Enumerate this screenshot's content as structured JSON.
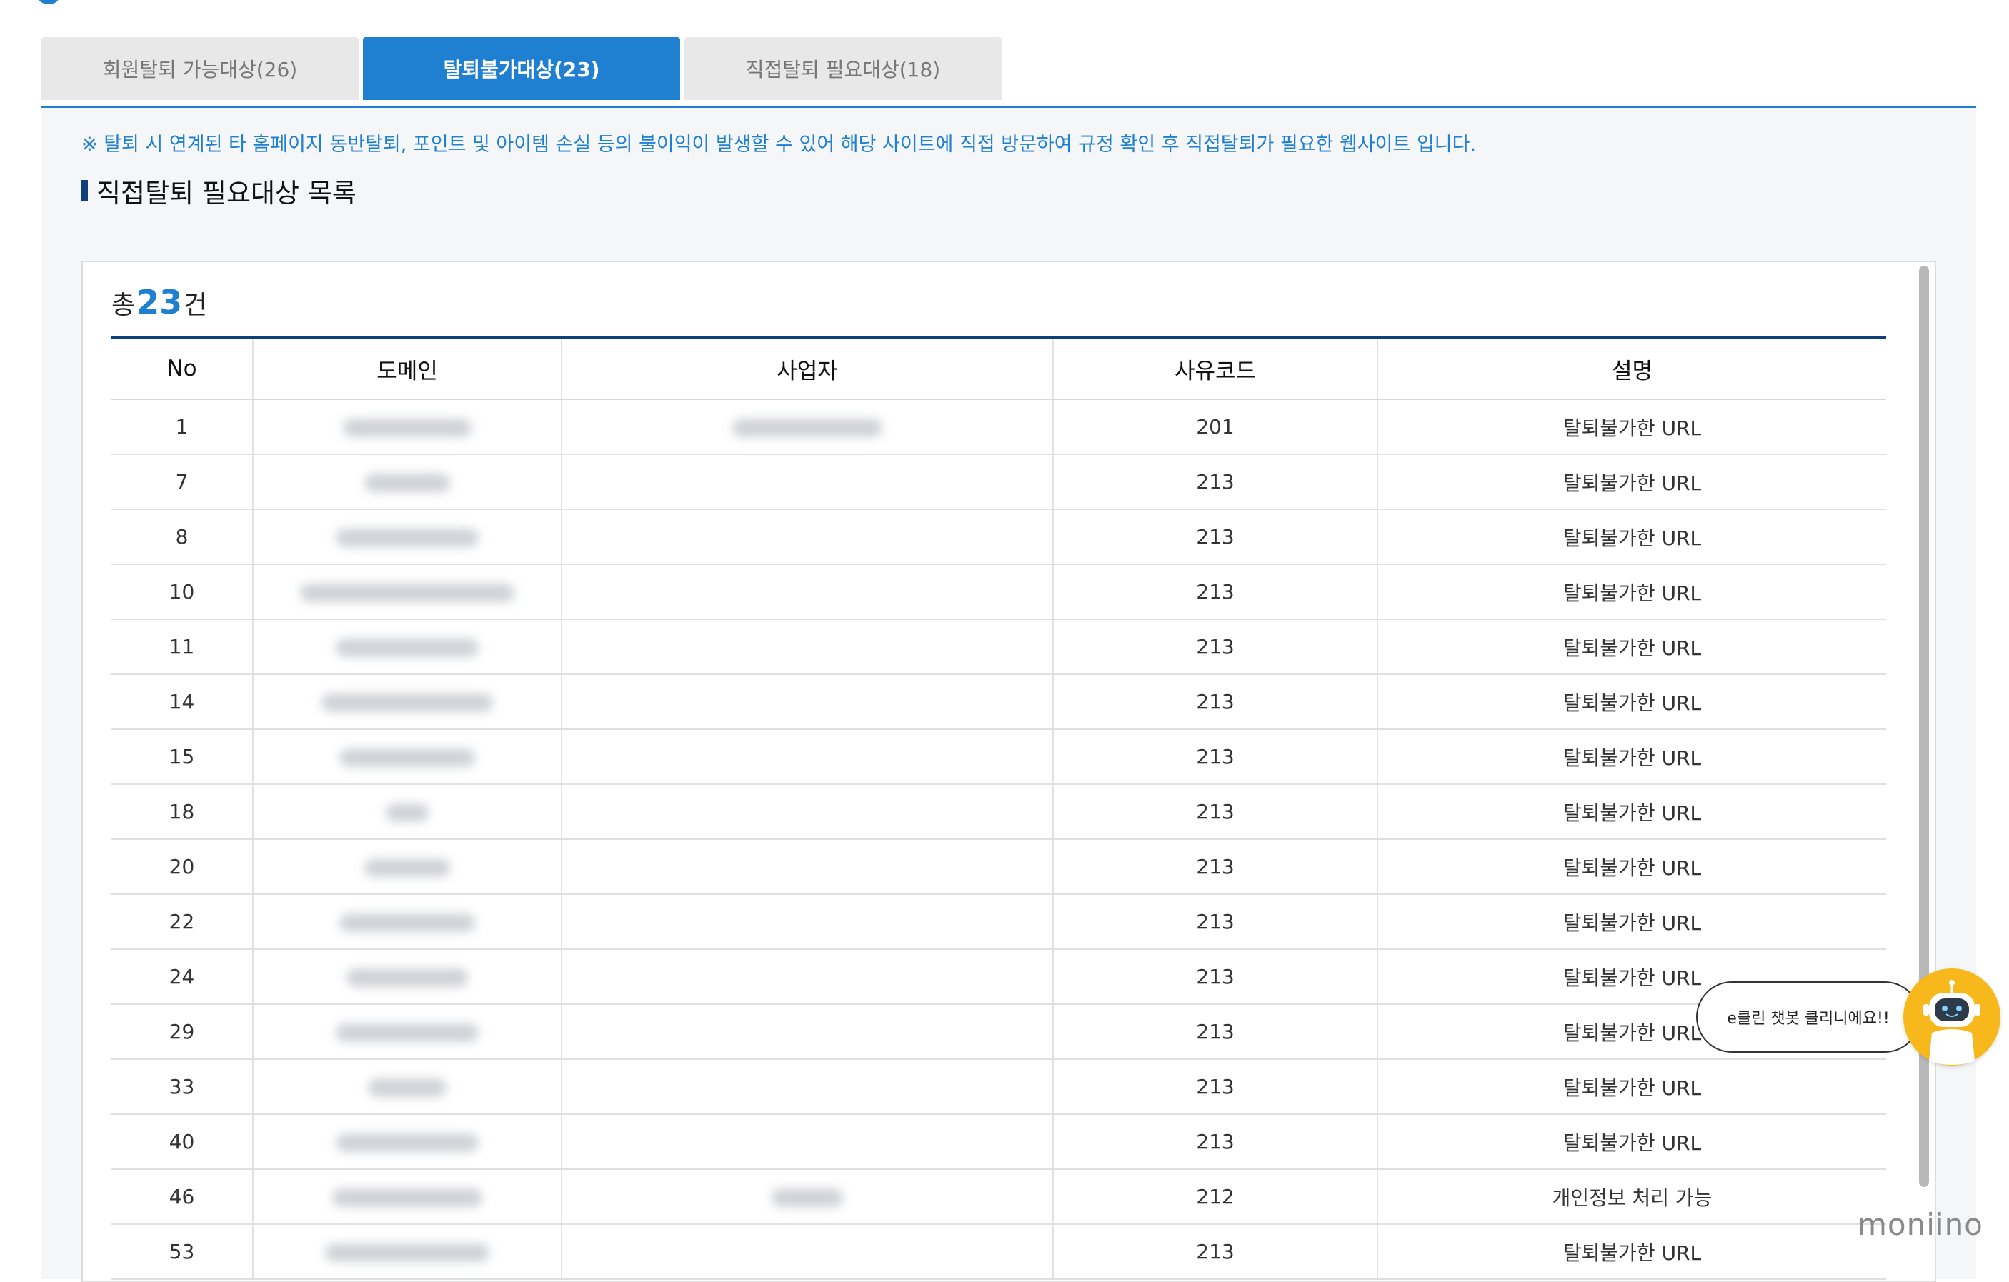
{
  "tabs": [
    {
      "label": "회원탈퇴 가능대상(26)",
      "active": false
    },
    {
      "label": "탈퇴불가대상(23)",
      "active": true
    },
    {
      "label": "직접탈퇴 필요대상(18)",
      "active": false
    }
  ],
  "notice": "※ 탈퇴 시 연계된 타 홈페이지 동반탈퇴, 포인트 및 아이템 손실 등의 불이익이 발생할 수 있어 해당 사이트에 직접 방문하여 규정 확인 후 직접탈퇴가 필요한 웹사이트 입니다.",
  "section_title": "직접탈퇴 필요대상 목록",
  "total": {
    "prefix": "총",
    "count": "23",
    "suffix": "건"
  },
  "table": {
    "headers": [
      "No",
      "도메인",
      "사업자",
      "사유코드",
      "설명"
    ],
    "rows": [
      {
        "no": "1",
        "code": "201",
        "desc": "탈퇴불가한 URL"
      },
      {
        "no": "7",
        "code": "213",
        "desc": "탈퇴불가한 URL"
      },
      {
        "no": "8",
        "code": "213",
        "desc": "탈퇴불가한 URL"
      },
      {
        "no": "10",
        "code": "213",
        "desc": "탈퇴불가한 URL"
      },
      {
        "no": "11",
        "code": "213",
        "desc": "탈퇴불가한 URL"
      },
      {
        "no": "14",
        "code": "213",
        "desc": "탈퇴불가한 URL"
      },
      {
        "no": "15",
        "code": "213",
        "desc": "탈퇴불가한 URL"
      },
      {
        "no": "18",
        "code": "213",
        "desc": "탈퇴불가한 URL"
      },
      {
        "no": "20",
        "code": "213",
        "desc": "탈퇴불가한 URL"
      },
      {
        "no": "22",
        "code": "213",
        "desc": "탈퇴불가한 URL"
      },
      {
        "no": "24",
        "code": "213",
        "desc": "탈퇴불가한 URL"
      },
      {
        "no": "29",
        "code": "213",
        "desc": "탈퇴불가한 URL"
      },
      {
        "no": "33",
        "code": "213",
        "desc": "탈퇴불가한 URL"
      },
      {
        "no": "40",
        "code": "213",
        "desc": "탈퇴불가한 URL"
      },
      {
        "no": "46",
        "code": "212",
        "desc": "개인정보 처리 가능"
      },
      {
        "no": "53",
        "code": "213",
        "desc": "탈퇴불가한 URL"
      }
    ]
  },
  "chatbot": {
    "bubble_text": "e클린 챗봇 클리니에요!!",
    "icon": "robot-icon"
  },
  "watermark": "moniino",
  "colors": {
    "accent": "#1f7fd1",
    "dark_accent": "#0d3f7a",
    "bot": "#f7b81c"
  }
}
